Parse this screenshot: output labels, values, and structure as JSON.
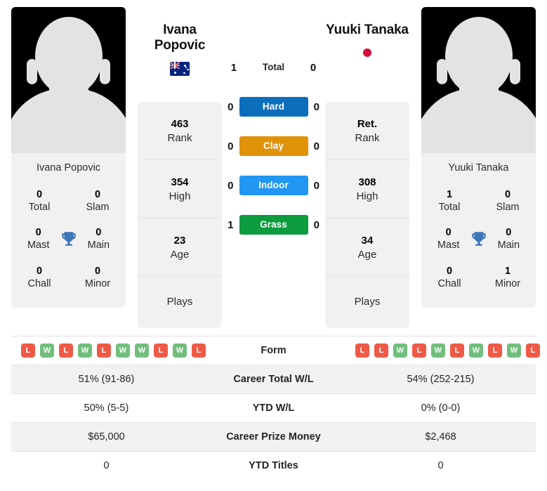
{
  "players": {
    "left": {
      "name": "Ivana Popovic",
      "name_line1": "Ivana",
      "name_line2": "Popovic",
      "flag": "australia-flag-icon",
      "photo_caption": "Ivana Popovic",
      "titles_panel_name": "Ivana Popovic",
      "titles": [
        {
          "value": "0",
          "label": "Total"
        },
        {
          "value": "0",
          "label": "Slam"
        },
        {
          "value": "0",
          "label": "Mast"
        },
        {
          "value": "0",
          "label": "Main"
        },
        {
          "value": "0",
          "label": "Chall"
        },
        {
          "value": "0",
          "label": "Minor"
        }
      ],
      "stats": [
        {
          "value": "463",
          "label": "Rank"
        },
        {
          "value": "354",
          "label": "High"
        },
        {
          "value": "23",
          "label": "Age"
        },
        {
          "value": "",
          "label": "Plays"
        }
      ],
      "form": [
        "L",
        "W",
        "L",
        "W",
        "L",
        "W",
        "W",
        "L",
        "W",
        "L"
      ]
    },
    "right": {
      "name": "Yuuki Tanaka",
      "name_line1": "Yuuki Tanaka",
      "name_line2": "",
      "flag": "japan-flag-icon",
      "photo_caption": "Yuuki Tanaka",
      "titles_panel_name": "Yuuki Tanaka",
      "titles": [
        {
          "value": "1",
          "label": "Total"
        },
        {
          "value": "0",
          "label": "Slam"
        },
        {
          "value": "0",
          "label": "Mast"
        },
        {
          "value": "0",
          "label": "Main"
        },
        {
          "value": "0",
          "label": "Chall"
        },
        {
          "value": "1",
          "label": "Minor"
        }
      ],
      "stats": [
        {
          "value": "Ret.",
          "label": "Rank"
        },
        {
          "value": "308",
          "label": "High"
        },
        {
          "value": "34",
          "label": "Age"
        },
        {
          "value": "",
          "label": "Plays"
        }
      ],
      "form": [
        "L",
        "L",
        "W",
        "L",
        "W",
        "L",
        "W",
        "L",
        "W",
        "L"
      ]
    }
  },
  "trophy_icon": "trophy-icon",
  "head_to_head": {
    "total": {
      "label": "Total",
      "left": "1",
      "right": "0"
    },
    "surfaces": [
      {
        "label": "Hard",
        "left": "0",
        "right": "0",
        "color": "#0b6ebd"
      },
      {
        "label": "Clay",
        "left": "0",
        "right": "0",
        "color": "#e09209"
      },
      {
        "label": "Indoor",
        "left": "0",
        "right": "0",
        "color": "#2196f3"
      },
      {
        "label": "Grass",
        "left": "1",
        "right": "0",
        "color": "#0c9b3f"
      }
    ]
  },
  "table": {
    "rows": [
      {
        "label": "Form",
        "left": "",
        "right": ""
      },
      {
        "label": "Career Total W/L",
        "left": "51% (91-86)",
        "right": "54% (252-215)"
      },
      {
        "label": "YTD W/L",
        "left": "50% (5-5)",
        "right": "0% (0-0)"
      },
      {
        "label": "Career Prize Money",
        "left": "$65,000",
        "right": "$2,468"
      },
      {
        "label": "YTD Titles",
        "left": "0",
        "right": "0"
      }
    ]
  },
  "colors": {
    "win": "#72be7d",
    "loss": "#ee5a47",
    "card_bg": "#f1f1f1",
    "trophy": "#3f76b8"
  }
}
